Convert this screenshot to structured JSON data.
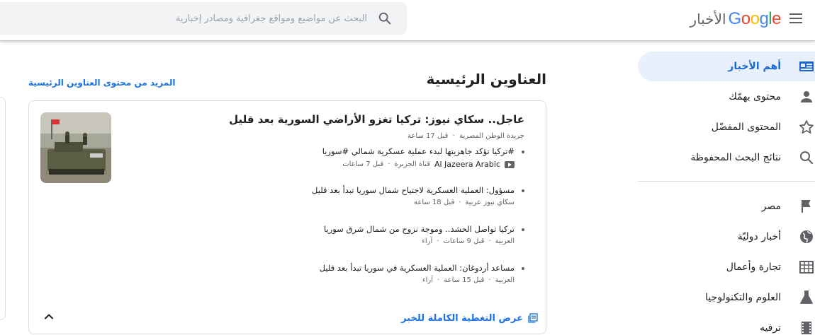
{
  "header": {
    "logo_google": [
      "G",
      "o",
      "o",
      "g",
      "l",
      "e"
    ],
    "logo_news": "الأخبار",
    "search_placeholder": "البحث عن مواضيع ومواقع جغرافية ومصادر إخبارية"
  },
  "sidebar": {
    "items": [
      {
        "label": "أهم الأخبار",
        "icon": "top-stories-icon",
        "active": true
      },
      {
        "label": "محتوى يهمّك",
        "icon": "person-icon"
      },
      {
        "label": "المحتوى المفضّل",
        "icon": "star-icon"
      },
      {
        "label": "نتائج البحث المحفوظة",
        "icon": "search-icon"
      }
    ],
    "sections": [
      {
        "label": "مصر",
        "icon": "flag-icon"
      },
      {
        "label": "أخبار دوليّة",
        "icon": "globe-icon"
      },
      {
        "label": "تجارة وأعمال",
        "icon": "business-icon"
      },
      {
        "label": "العلوم والتكنولوجيا",
        "icon": "flask-icon"
      },
      {
        "label": "ترفيه",
        "icon": "film-icon"
      }
    ]
  },
  "main": {
    "section_title": "العناوين الرئيسية",
    "more_link": "المزيد من محتوى العناوين الرئيسية",
    "lead": {
      "title": "عاجل.. سكاي نيوز: تركيا تغزو الأراضي السورية بعد قليل",
      "source": "جريدة الوطن المصرية",
      "time": "قبل 17 ساعة"
    },
    "stories": [
      {
        "title": "#تركيا تؤكد جاهزيتها لبدء عملية عسكرية شمالي #سوريا",
        "source": "Al Jazeera Arabic",
        "source2": "قناة الجزيرة",
        "time": "قبل 7 ساعات",
        "video": true
      },
      {
        "title": "مسؤول: العملية العسكرية لاجتياح شمال سوريا تبدأ بعد قليل",
        "source": "سكاي نيوز عربية",
        "time": "قبل 18 ساعة"
      },
      {
        "title": "تركيا تواصل الحشد.. وموجة نزوح من شمال شرق سوريا",
        "source": "العربية",
        "time": "قبل 9 ساعات",
        "tag": "آراء"
      },
      {
        "title": "مساعد أردوغان: العملية العسكرية في سوريا تبدأ بعد قليل",
        "source": "العربية",
        "time": "قبل 15 ساعة",
        "tag": "آراء"
      }
    ],
    "full_coverage": "عرض التغطية الكاملة للخبر"
  },
  "colors": {
    "accent": "#1a73e8",
    "active_bg": "#e8f0fe",
    "active_text": "#1967d2"
  }
}
